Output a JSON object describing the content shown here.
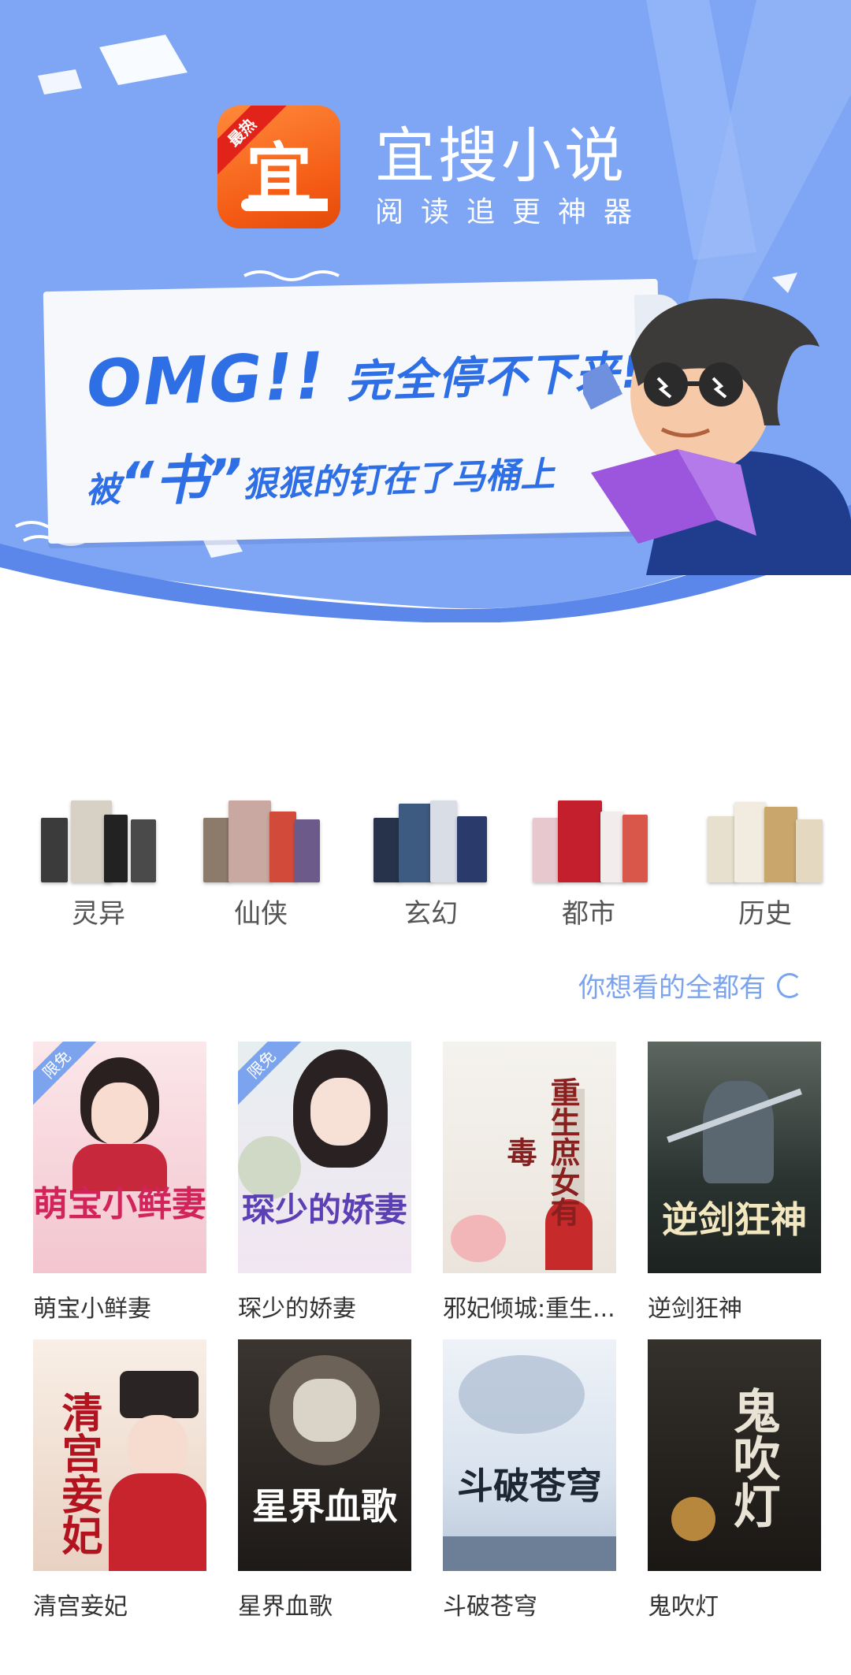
{
  "app": {
    "name": "宜搜小说",
    "slogan": "阅读追更神器",
    "icon_badge": "最热",
    "icon_glyph": "宜"
  },
  "banner": {
    "headline_en": "OMG!!",
    "headline_cn": "完全停不下来!!",
    "subline_pre": "被",
    "subline_quote": "“书”",
    "subline_post": "狠狠的钉在了马桶上",
    "colors": {
      "sky": "#7ea6f4",
      "sky_dark": "#5b86ea",
      "text": "#2e6fe6"
    }
  },
  "categories": [
    {
      "label": "灵异",
      "icon": "category-lingyi-books"
    },
    {
      "label": "仙侠",
      "icon": "category-xianxia-books"
    },
    {
      "label": "玄幻",
      "icon": "category-xuanhuan-books"
    },
    {
      "label": "都市",
      "icon": "category-dushi-books"
    },
    {
      "label": "历史",
      "icon": "category-lishi-books"
    }
  ],
  "tagline": "你想看的全都有",
  "books": [
    {
      "title": "萌宝小鲜妻",
      "badge": "限免",
      "cover_text": "萌宝小鲜妻"
    },
    {
      "title": "琛少的娇妻",
      "badge": "限免",
      "cover_text": "琛少的娇妻"
    },
    {
      "title": "邪妃倾城:重生...",
      "badge": "",
      "cover_text": "重生庶女有毒"
    },
    {
      "title": "逆剑狂神",
      "badge": "",
      "cover_text": "逆剑狂神"
    },
    {
      "title": "清宫妾妃",
      "badge": "",
      "cover_text": "清宫妾妃"
    },
    {
      "title": "星界血歌",
      "badge": "",
      "cover_text": "星界血歌"
    },
    {
      "title": "斗破苍穹",
      "badge": "",
      "cover_text": "斗破苍穹"
    },
    {
      "title": "鬼吹灯",
      "badge": "",
      "cover_text": "鬼吹灯"
    }
  ]
}
